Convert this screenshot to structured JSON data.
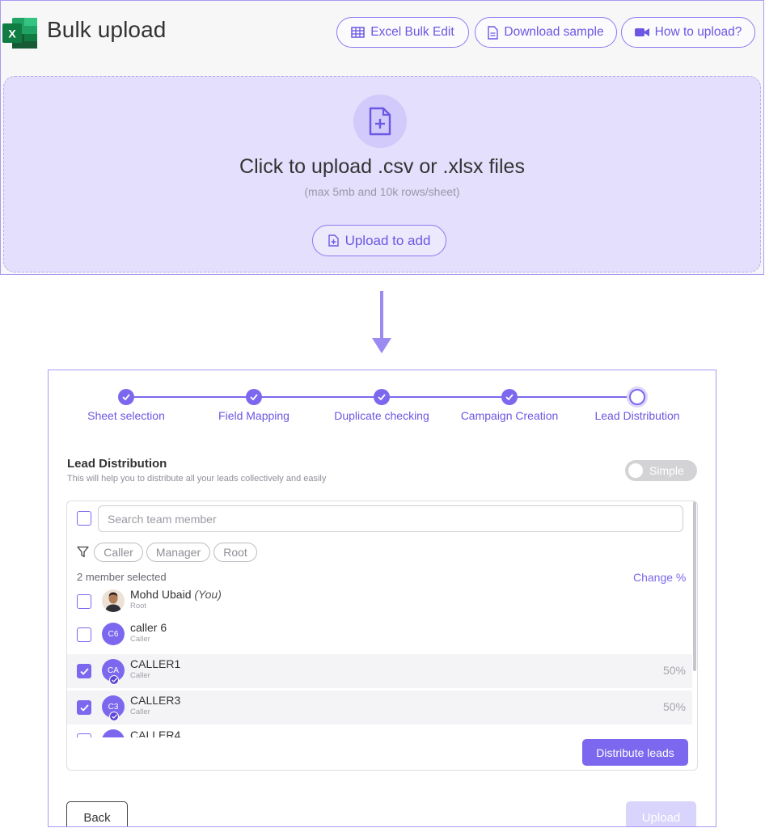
{
  "header": {
    "title": "Bulk upload",
    "buttons": {
      "excel_bulk_edit": "Excel Bulk Edit",
      "download_sample": "Download sample",
      "how_to_upload": "How to upload?"
    }
  },
  "dropzone": {
    "title": "Click to upload .csv or .xlsx files",
    "subtitle": "(max 5mb and 10k rows/sheet)",
    "button": "Upload to add"
  },
  "stepper": {
    "steps": [
      {
        "label": "Sheet selection",
        "state": "done"
      },
      {
        "label": "Field Mapping",
        "state": "done"
      },
      {
        "label": "Duplicate checking",
        "state": "done"
      },
      {
        "label": "Campaign Creation",
        "state": "done"
      },
      {
        "label": "Lead Distribution",
        "state": "current"
      }
    ]
  },
  "lead_distribution": {
    "title": "Lead Distribution",
    "description": "This will help you to distribute all your leads collectively and easily",
    "mode_toggle": "Simple",
    "search_placeholder": "Search team member",
    "filter_chips": [
      "Caller",
      "Manager",
      "Root"
    ],
    "selected_count": "2 member selected",
    "change_percent": "Change %",
    "members": [
      {
        "name": "Mohd Ubaid",
        "suffix": "(You)",
        "role": "Root",
        "initials": "",
        "selected": false,
        "percent": ""
      },
      {
        "name": "caller 6",
        "suffix": "",
        "role": "Caller",
        "initials": "C6",
        "selected": false,
        "percent": ""
      },
      {
        "name": "CALLER1",
        "suffix": "",
        "role": "Caller",
        "initials": "CA",
        "selected": true,
        "percent": "50%"
      },
      {
        "name": "CALLER3",
        "suffix": "",
        "role": "Caller",
        "initials": "C3",
        "selected": true,
        "percent": "50%"
      },
      {
        "name": "CALLER4",
        "suffix": "",
        "role": "",
        "initials": "",
        "selected": false,
        "percent": ""
      }
    ],
    "distribute_button": "Distribute leads"
  },
  "footer": {
    "back": "Back",
    "upload": "Upload"
  },
  "colors": {
    "accent": "#7b68ee",
    "accent_text": "#6a57e3",
    "dropzone_bg": "#e3dffc",
    "excel_green": "#1d6f42"
  }
}
